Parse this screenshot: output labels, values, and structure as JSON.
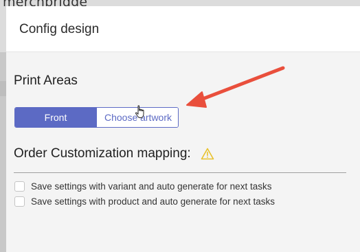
{
  "background": {
    "app_name": "merchbridge"
  },
  "modal": {
    "title": "Config design"
  },
  "print_areas": {
    "heading": "Print Areas",
    "buttons": [
      {
        "label": "Front",
        "active": true
      },
      {
        "label": "Choose artwork",
        "active": false
      }
    ]
  },
  "mapping": {
    "heading": "Order Customization mapping:",
    "options": [
      {
        "label": "Save settings with variant and auto generate for next tasks",
        "checked": false
      },
      {
        "label": "Save settings with product and auto generate for next tasks",
        "checked": false
      }
    ]
  },
  "colors": {
    "accent": "#5c6ac4",
    "warning": "#e8c12b",
    "annotation_arrow": "#e94f3c"
  },
  "icons": {
    "warning": "warning-triangle-icon",
    "cursor": "hand-pointer-cursor-icon"
  }
}
